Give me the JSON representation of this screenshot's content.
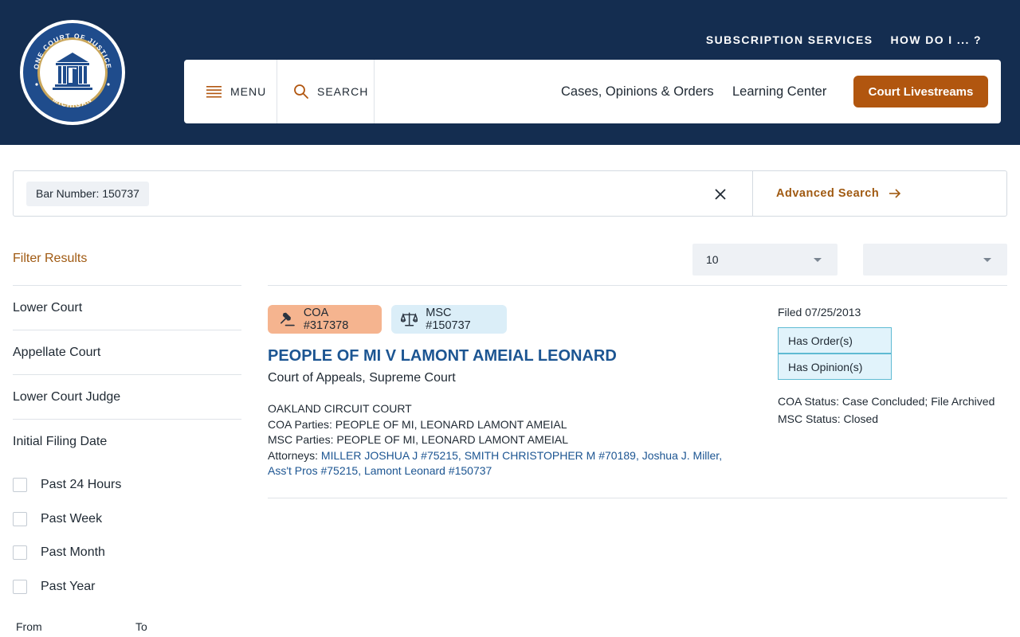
{
  "header": {
    "seal_top_text": "ONE COURT OF JUSTICE",
    "seal_bottom_text": "MICHIGAN",
    "util_links": [
      "SUBSCRIPTION SERVICES",
      "HOW DO I ... ?"
    ],
    "menu_label": "MENU",
    "search_label": "SEARCH",
    "nav_links": [
      "Cases, Opinions & Orders",
      "Learning Center"
    ],
    "livestream_label": "Court Livestreams"
  },
  "search": {
    "chip": "Bar Number: 150737",
    "advanced_label": "Advanced Search"
  },
  "sidebar": {
    "title": "Filter Results",
    "filters": [
      "Lower Court",
      "Appellate Court",
      "Lower Court Judge",
      "Initial Filing Date"
    ],
    "date_options": [
      "Past 24 Hours",
      "Past Week",
      "Past Month",
      "Past Year"
    ],
    "from_label": "From",
    "to_label": "To"
  },
  "controls": {
    "page_size": "10",
    "sort": ""
  },
  "result": {
    "coa_badge": "COA #317378",
    "msc_badge": "MSC #150737",
    "title": "PEOPLE OF MI V LAMONT AMEIAL LEONARD",
    "courts": "Court of Appeals, Supreme Court",
    "lower_court": "OAKLAND CIRCUIT COURT",
    "coa_parties": "COA Parties: PEOPLE OF MI, LEONARD LAMONT AMEIAL",
    "msc_parties": "MSC Parties: PEOPLE OF MI, LEONARD LAMONT AMEIAL",
    "attorneys_label": "Attorneys: ",
    "attorneys": [
      "MILLER JOSHUA J #75215",
      "SMITH CHRISTOPHER M #70189",
      "Joshua J. Miller, Ass't Pros #75215",
      "Lamont Leonard #150737"
    ],
    "filed": "Filed 07/25/2013",
    "tags": [
      "Has Order(s)",
      "Has Opinion(s)"
    ],
    "coa_status": "COA Status: Case Concluded; File Archived",
    "msc_status": "MSC Status: Closed"
  },
  "colors": {
    "header_bg": "#142d50",
    "accent": "#b1560f",
    "link": "#1c5592"
  }
}
